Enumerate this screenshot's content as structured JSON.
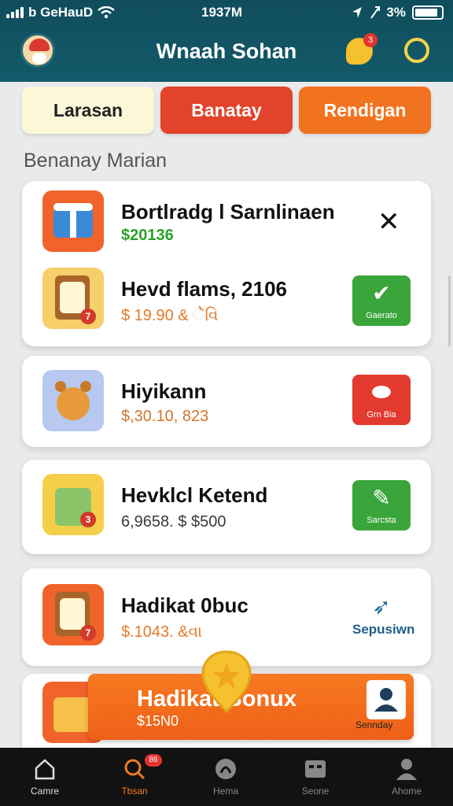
{
  "status": {
    "carrier": "b GeHauD",
    "time": "1937M",
    "right_text": "3%"
  },
  "header": {
    "title": "Wnaah Sohan",
    "chat_badge": "3"
  },
  "tabs": [
    {
      "label": "Larasan"
    },
    {
      "label": "Banatay"
    },
    {
      "label": "Rendigan"
    }
  ],
  "section_title": "Benanay Marian",
  "items": [
    {
      "title": "Bortlradg l Sarnlinaen",
      "sub": "$20136",
      "sub_color": "#2aa02a"
    },
    {
      "title": "Hevd flams, 2106",
      "sub": "$ 19.90 & ેૅવિ",
      "sub_color": "#e27a2a",
      "action": "Gaerato"
    },
    {
      "title": "Hiyikann",
      "sub": "$,30.10, 823",
      "sub_color": "#d0762a",
      "action": "Grn Bia"
    },
    {
      "title": "Hevklcl Ketend",
      "sub": "6,9658. $ $500",
      "sub_color": "#3a3a3a",
      "action": "Sarcsta"
    },
    {
      "title": "Hadikat 0buc",
      "sub": "$.1043. &વા",
      "sub_color": "#e27a2a",
      "action": "Sepusiwn"
    }
  ],
  "bonus": {
    "title": "Hadikat Bonux",
    "amount": "$15N0",
    "user_label": "Sennday"
  },
  "nav": [
    {
      "label": "Camre"
    },
    {
      "label": "Tbsan",
      "badge": "86"
    },
    {
      "label": "Hema"
    },
    {
      "label": "Seone"
    },
    {
      "label": "Ahome"
    }
  ]
}
